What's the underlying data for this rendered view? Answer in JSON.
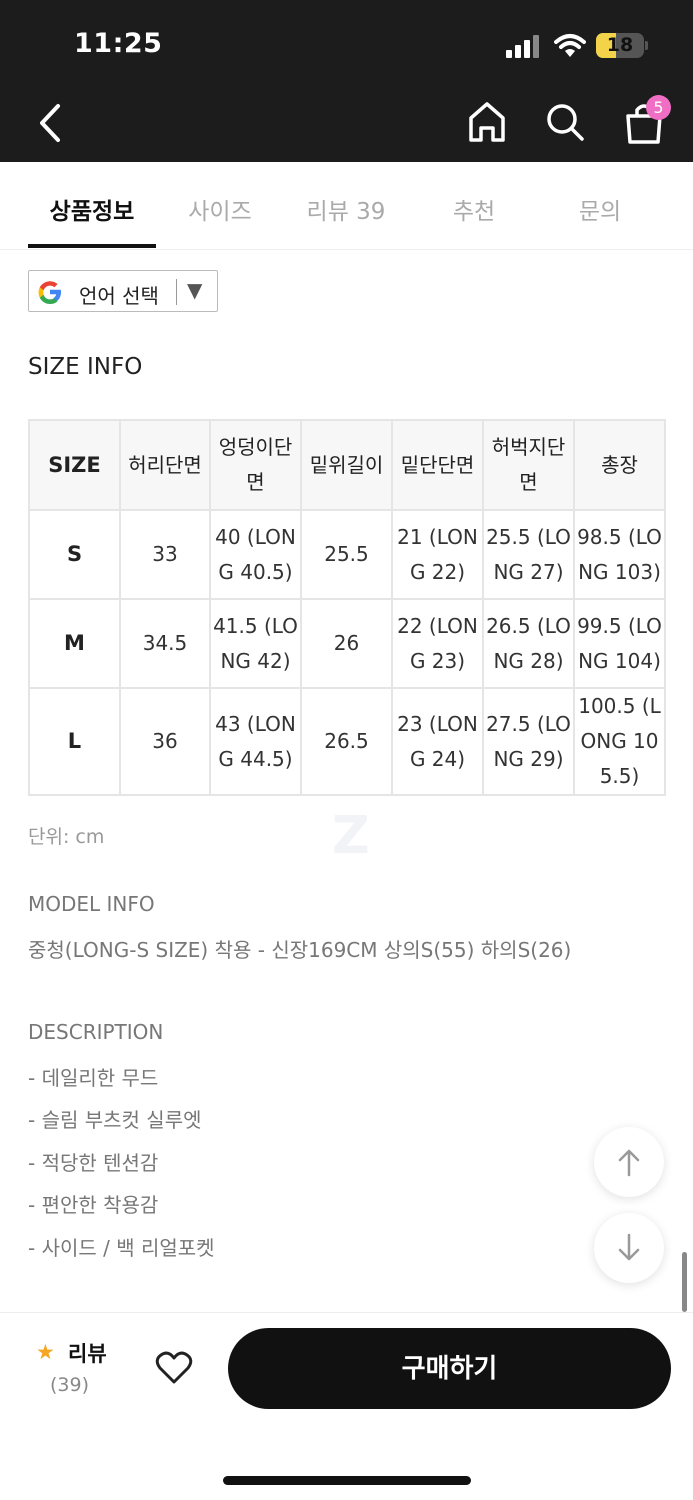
{
  "status_bar": {
    "time": "11:25",
    "battery": "18"
  },
  "header": {
    "cart_badge": "5"
  },
  "tabs": [
    {
      "label": "상품정보",
      "active": true
    },
    {
      "label": "사이즈",
      "active": false
    },
    {
      "label": "리뷰 39",
      "active": false
    },
    {
      "label": "추천",
      "active": false
    },
    {
      "label": "문의",
      "active": false
    }
  ],
  "language_selector": {
    "label": "언어 선택",
    "arrow": "▼"
  },
  "size_info": {
    "title": "SIZE INFO",
    "columns": [
      "SIZE",
      "허리단면",
      "엉덩이단면",
      "밑위길이",
      "밑단단면",
      "허벅지단면",
      "총장"
    ],
    "rows": [
      [
        "S",
        "33",
        "40 (LONG 40.5)",
        "25.5",
        "21 (LONG 22)",
        "25.5 (LONG 27)",
        "98.5 (LONG 103)"
      ],
      [
        "M",
        "34.5",
        "41.5 (LONG 42)",
        "26",
        "22 (LONG 23)",
        "26.5 (LONG 28)",
        "99.5 (LONG 104)"
      ],
      [
        "L",
        "36",
        "43 (LONG 44.5)",
        "26.5",
        "23 (LONG 24)",
        "27.5 (LONG 29)",
        "100.5 (LONG 105.5)"
      ]
    ],
    "unit": "단위: cm",
    "watermark": "Z"
  },
  "model_info": {
    "title": "MODEL INFO",
    "text": "중청(LONG-S SIZE) 착용 - 신장169CM 상의S(55) 하의S(26)"
  },
  "description": {
    "title": "DESCRIPTION",
    "items": [
      "- 데일리한 무드",
      "- 슬림 부츠컷 실루엣",
      "- 적당한 텐션감",
      "- 편안한 착용감",
      "- 사이드 / 백 리얼포켓"
    ]
  },
  "bottom_bar": {
    "review_label": "리뷰",
    "review_count": "(39)",
    "buy_label": "구매하기"
  },
  "colors": {
    "accent_badge": "#f06fc4",
    "star": "#f5a623",
    "dark": "#1c1c1c"
  },
  "icons": [
    "back-icon",
    "home-icon",
    "search-icon",
    "shopping-bag-icon",
    "google-icon",
    "arrow-up-icon",
    "arrow-down-icon",
    "heart-icon",
    "star-icon"
  ]
}
